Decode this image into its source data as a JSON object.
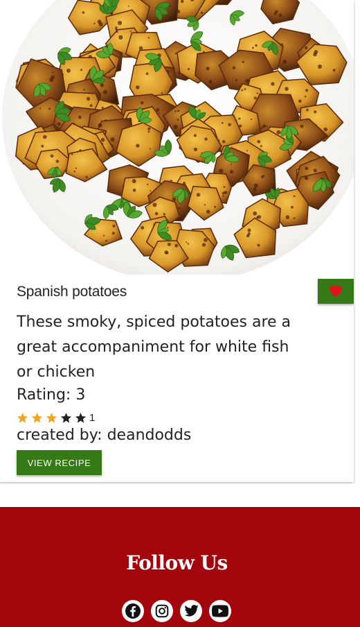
{
  "recipe": {
    "title": "Spanish potatoes",
    "description": "These smoky, spiced potatoes are a great accompaniment for white fish or chicken",
    "rating_text": "Rating: 3",
    "rating_value": 3,
    "rating_max": 5,
    "rating_count": "1",
    "creator": "created by: deandodds",
    "view_label": "VIEW RECIPE",
    "image_subject": "spiced roasted potatoes with parsley"
  },
  "icons": {
    "favorite": "heart-icon",
    "star": "star-icon",
    "facebook": "facebook-icon",
    "instagram": "instagram-icon",
    "twitter": "twitter-icon",
    "youtube": "youtube-icon"
  },
  "footer": {
    "title": "Follow Us"
  },
  "colors": {
    "button_green": "#357a17",
    "footer_red": "#a3050c",
    "star_filled": "#f2a51a",
    "star_empty": "#222222",
    "heart_red": "#e3111c"
  }
}
